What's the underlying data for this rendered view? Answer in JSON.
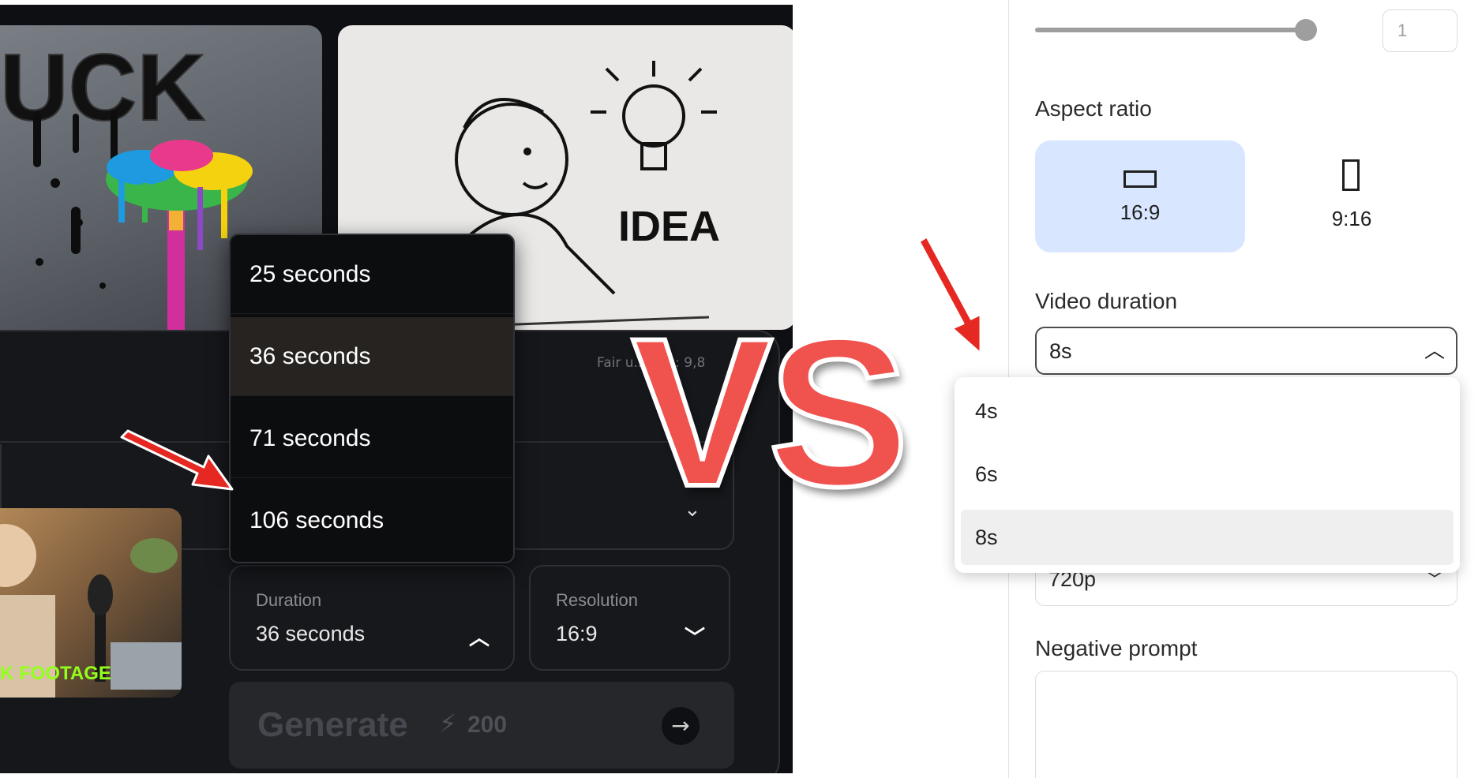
{
  "left_app": {
    "fair_usage_text": "Fair u... dits: 9,8",
    "thumbnails": {
      "idea_text": "IDEA",
      "stock_caption": "K FOOTAGE"
    },
    "duration_menu": {
      "options": [
        "25 seconds",
        "36 seconds",
        "71 seconds",
        "106 seconds"
      ],
      "selected": "36 seconds"
    },
    "duration_field": {
      "label": "Duration",
      "value": "36 seconds"
    },
    "resolution_field": {
      "label": "Resolution",
      "value": "16:9"
    },
    "generate": {
      "label": "Generate",
      "cost": "200"
    }
  },
  "vs_text": "VS",
  "right_app": {
    "count_value": "1",
    "slider_level": 1.0,
    "aspect_ratio": {
      "label": "Aspect ratio",
      "options": [
        "16:9",
        "9:16"
      ],
      "selected": "16:9"
    },
    "video_duration": {
      "label": "Video duration",
      "value": "8s",
      "options": [
        "4s",
        "6s",
        "8s"
      ],
      "selected": "8s"
    },
    "resolution_value": "720p",
    "negative_prompt": {
      "label": "Negative prompt",
      "value": ""
    }
  },
  "colors": {
    "vs": "#f0524e",
    "arrow": "#e52822",
    "dark_bg": "#0e0f12",
    "accent_green": "#93ff1a",
    "selected_ratio": "#d8e7ff"
  }
}
